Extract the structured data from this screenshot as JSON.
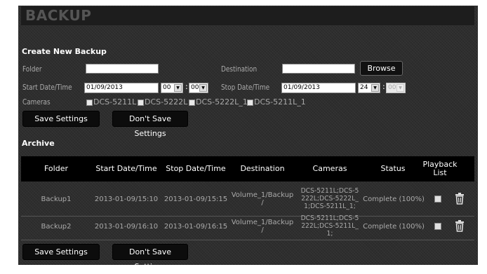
{
  "page": {
    "title": "BACKUP"
  },
  "create": {
    "heading": "Create New Backup",
    "folder_label": "Folder",
    "folder_value": "",
    "destination_label": "Destination",
    "destination_value": "",
    "browse_label": "Browse",
    "start_label": "Start Date/Time",
    "start_date": "01/09/2013",
    "start_hour": "00",
    "start_minute": "00",
    "stop_label": "Stop Date/Time",
    "stop_date": "01/09/2013",
    "stop_hour": "24",
    "stop_minute": "00",
    "time_sep": ":",
    "cameras_label": "Cameras",
    "cameras": [
      "DCS-5211L",
      "DCS-5222L",
      "DCS-5222L_1",
      "DCS-5211L_1"
    ],
    "save_label": "Save Settings",
    "dont_save_label": "Don't Save Settings"
  },
  "archive": {
    "heading": "Archive",
    "columns": {
      "folder": "Folder",
      "start": "Start Date/Time",
      "stop": "Stop Date/Time",
      "destination": "Destination",
      "cameras": "Cameras",
      "status": "Status",
      "playback_1": "Playback",
      "playback_2": "List"
    },
    "rows": [
      {
        "folder": "Backup1",
        "start": "2013-01-09/15:10",
        "stop": "2013-01-09/15:15",
        "dest_1": "Volume_1/Backup",
        "dest_2": "/",
        "cam_1": "DCS-5211L;DCS-5",
        "cam_2": "222L;DCS-5222L_",
        "cam_3": "1;DCS-5211L_1;",
        "status": "Complete (100%)"
      },
      {
        "folder": "Backup2",
        "start": "2013-01-09/16:10",
        "stop": "2013-01-09/16:15",
        "dest_1": "Volume_1/Backup",
        "dest_2": "/",
        "cam_1": "DCS-5211L;DCS-5",
        "cam_2": "222L;DCS-5211L_",
        "cam_3": "1;",
        "status": "Complete (100%)"
      }
    ]
  },
  "footer": {
    "save_label": "Save Settings",
    "dont_save_label": "Don't Save Settings"
  },
  "icons": {
    "delete": "trash-icon",
    "dropdown": "dropdown-arrow-icon"
  },
  "colors": {
    "panel_bg": "#2e2e2e",
    "header_bg": "#000000",
    "label": "#aaaaaa",
    "heading": "#ffffff",
    "button_bg": "#0c0c0c"
  }
}
